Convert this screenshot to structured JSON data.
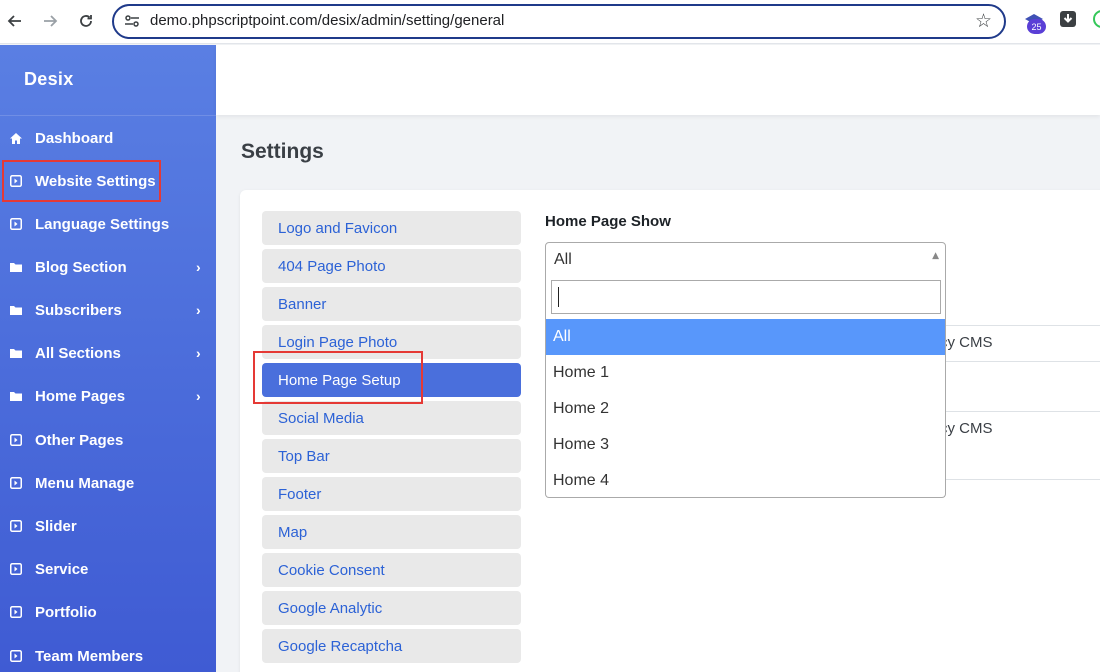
{
  "browser": {
    "url": "demo.phpscriptpoint.com/desix/admin/setting/general",
    "extension_badge": "25"
  },
  "sidebar": {
    "brand": "Desix",
    "items": [
      {
        "label": "Dashboard",
        "icon": "home-icon",
        "has_submenu": false
      },
      {
        "label": "Website Settings",
        "icon": "square-caret-icon",
        "has_submenu": false
      },
      {
        "label": "Language Settings",
        "icon": "square-caret-icon",
        "has_submenu": false
      },
      {
        "label": "Blog Section",
        "icon": "folder-icon",
        "has_submenu": true
      },
      {
        "label": "Subscribers",
        "icon": "folder-icon",
        "has_submenu": true
      },
      {
        "label": "All Sections",
        "icon": "folder-icon",
        "has_submenu": true
      },
      {
        "label": "Home Pages",
        "icon": "folder-icon",
        "has_submenu": true
      },
      {
        "label": "Other Pages",
        "icon": "square-caret-icon",
        "has_submenu": false
      },
      {
        "label": "Menu Manage",
        "icon": "square-caret-icon",
        "has_submenu": false
      },
      {
        "label": "Slider",
        "icon": "square-caret-icon",
        "has_submenu": false
      },
      {
        "label": "Service",
        "icon": "square-caret-icon",
        "has_submenu": false
      },
      {
        "label": "Portfolio",
        "icon": "square-caret-icon",
        "has_submenu": false
      },
      {
        "label": "Team Members",
        "icon": "square-caret-icon",
        "has_submenu": false
      }
    ],
    "chevron": "›"
  },
  "main": {
    "page_title": "Settings",
    "settings_menu": [
      "Logo and Favicon",
      "404 Page Photo",
      "Banner",
      "Login Page Photo",
      "Home Page Setup",
      "Social Media",
      "Top Bar",
      "Footer",
      "Map",
      "Cookie Consent",
      "Google Analytic",
      "Google Recaptcha"
    ],
    "active_menu": "Home Page Setup",
    "field_label": "Home Page Show",
    "select": {
      "value": "All",
      "search_value": "",
      "options": [
        "All",
        "Home 1",
        "Home 2",
        "Home 3",
        "Home 4"
      ],
      "highlighted": "All"
    },
    "background_fragments": [
      "cy CMS",
      "cy CMS"
    ]
  },
  "colors": {
    "sidebar_top": "#5a7fe3",
    "sidebar_bottom": "#3f5bd3",
    "active_menu": "#4a6fdc",
    "link": "#2c62d6",
    "highlight_box": "#e53935",
    "dropdown_highlight": "#5897fb"
  }
}
